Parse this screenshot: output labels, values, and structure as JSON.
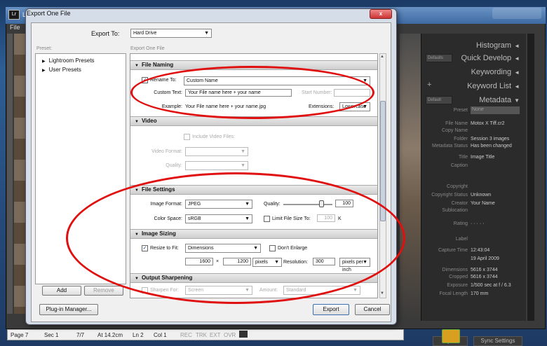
{
  "background": {
    "lr_title": "Ligh",
    "lr_menu": "File",
    "right_panel": {
      "histogram": "Histogram",
      "preset_default": "Defaults",
      "quick_develop": "Quick Develop",
      "keywording": "Keywording",
      "plus": "+",
      "keyword_list": "Keyword List",
      "metadata_default": "Default",
      "metadata": "Metadata",
      "preset_label": "Preset",
      "preset_value": "None",
      "rows": [
        {
          "label": "File Name",
          "value": "Motox X Tiff.cr2"
        },
        {
          "label": "Copy Name",
          "value": ""
        },
        {
          "label": "Folder",
          "value": "Session 3 images"
        },
        {
          "label": "Metadata Status",
          "value": "Has been changed"
        },
        {
          "label": "Title",
          "value": "Image Title"
        },
        {
          "label": "Caption",
          "value": ""
        },
        {
          "label": "Copyright",
          "value": ""
        },
        {
          "label": "Copyright Status",
          "value": "Unknown"
        },
        {
          "label": "Creator",
          "value": "Your Name"
        },
        {
          "label": "Sublocation",
          "value": ""
        },
        {
          "label": "Rating",
          "value": "· · · · ·"
        },
        {
          "label": "Label",
          "value": ""
        },
        {
          "label": "Capture Time",
          "value": "12:43:04"
        },
        {
          "label": "",
          "value": "19 April 2009"
        },
        {
          "label": "Dimensions",
          "value": "5616 x 3744"
        },
        {
          "label": "Cropped",
          "value": "5616 x 3744"
        },
        {
          "label": "Exposure",
          "value": "1/500 sec at f / 6.3"
        },
        {
          "label": "Focal Length",
          "value": "170 mm"
        }
      ],
      "sync_label": "Sync",
      "sync_settings_label": "Sync Settings"
    },
    "statusbar": {
      "page": "Page 7",
      "sec": "Sec 1",
      "pos": "7/7",
      "at": "At 14.2cm",
      "ln": "Ln 2",
      "col": "Col 1",
      "rec": "REC",
      "trk": "TRK",
      "ext": "EXT",
      "ovr": "OVR"
    }
  },
  "dialog": {
    "title": "Export One File",
    "close": "x",
    "export_to_label": "Export To:",
    "export_to_value": "Hard Drive",
    "preset_caption": "Preset:",
    "export_caption": "Export One File",
    "presets": [
      "Lightroom Presets",
      "User Presets"
    ],
    "add_label": "Add",
    "remove_label": "Remove",
    "plugin_manager_label": "Plug-in Manager...",
    "export_label": "Export",
    "cancel_label": "Cancel",
    "file_naming": {
      "header": "File Naming",
      "rename_to_label": "Rename To:",
      "rename_to_value": "Custom Name",
      "custom_text_label": "Custom Text:",
      "custom_text_value": "Your File name here + your name",
      "start_number_label": "Start Number:",
      "example_label": "Example:",
      "example_value": "Your File name here + your name.jpg",
      "extensions_label": "Extensions:",
      "extensions_value": "Lowercase"
    },
    "video": {
      "header": "Video",
      "include_label": "Include Video Files:",
      "format_label": "Video Format:",
      "quality_label": "Quality:"
    },
    "file_settings": {
      "header": "File Settings",
      "format_label": "Image Format:",
      "format_value": "JPEG",
      "quality_label": "Quality:",
      "quality_value": "100",
      "color_space_label": "Color Space:",
      "color_space_value": "sRGB",
      "limit_label": "Limit File Size To:",
      "limit_value": "100",
      "limit_unit": "K"
    },
    "image_sizing": {
      "header": "Image Sizing",
      "resize_label": "Resize to Fit:",
      "resize_value": "Dimensions",
      "dont_enlarge_label": "Don't Enlarge",
      "width": "1600",
      "times": "×",
      "height": "1200",
      "unit_value": "pixels",
      "resolution_label": "Resolution:",
      "resolution_value": "300",
      "resolution_unit": "pixels per inch"
    },
    "output_sharpening": {
      "header": "Output Sharpening",
      "sharpen_label": "Sharpen For:",
      "sharpen_value": "Screen",
      "amount_label": "Amount:",
      "amount_value": "Standard"
    }
  }
}
